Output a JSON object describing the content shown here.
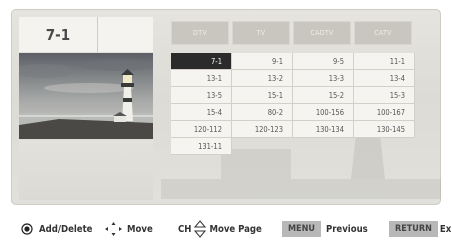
{
  "current_channel": "7-1",
  "tabs": [
    "DTV",
    "TV",
    "CADTV",
    "CATV"
  ],
  "channels": [
    "7-1",
    "9-1",
    "9-5",
    "11-1",
    "13-1",
    "13-2",
    "13-3",
    "13-4",
    "13-5",
    "15-1",
    "15-2",
    "15-3",
    "15-4",
    "80-2",
    "100-156",
    "100-167",
    "120-112",
    "120-123",
    "130-134",
    "130-145",
    "131-11"
  ],
  "selected_index": 0,
  "legend": {
    "add_delete": "Add/Delete",
    "move": "Move",
    "ch": "CH",
    "move_page": "Move Page",
    "menu_key": "MENU",
    "previous": "Previous",
    "return_key": "RETURN",
    "exit": "Ex"
  },
  "colors": {
    "selected_bg": "#2b2b2b",
    "cell_bg": "#f5f4f0",
    "key_bg": "#b8b8b8"
  },
  "icons": [
    "ok-button-icon",
    "four-way-arrows-icon",
    "up-down-arrows-icon"
  ]
}
